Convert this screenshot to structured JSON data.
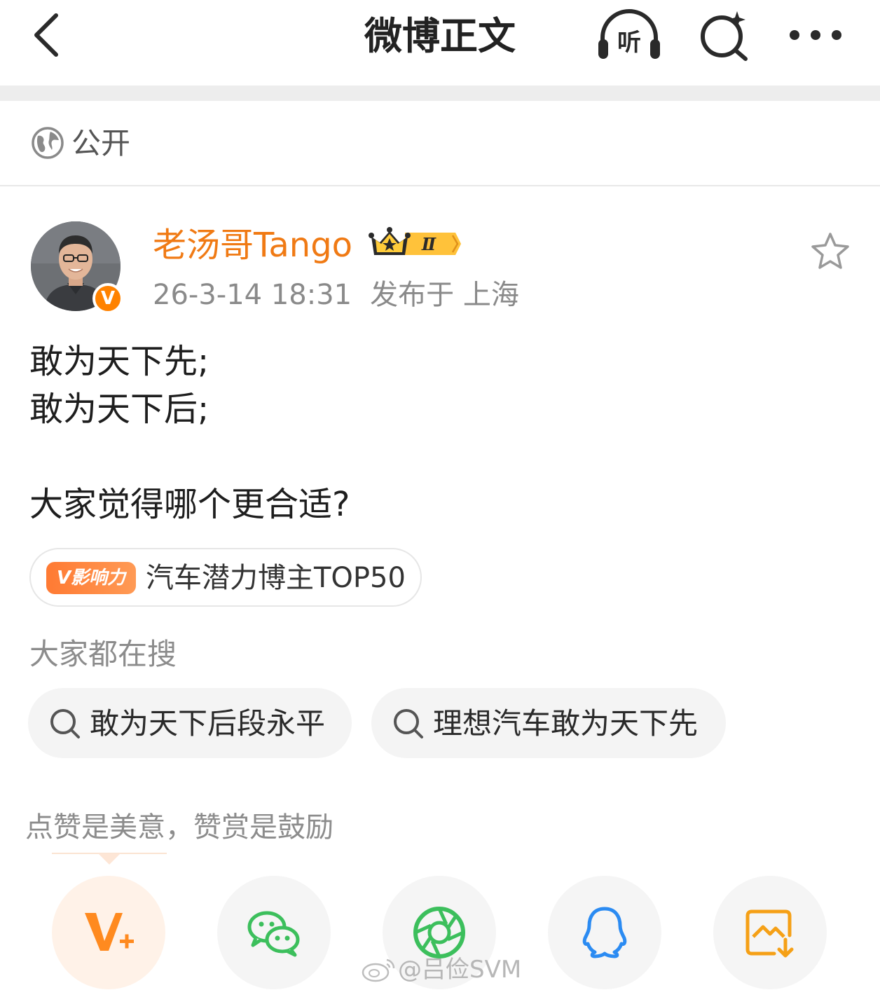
{
  "header": {
    "title": "微博正文",
    "listen_label": "听"
  },
  "visibility": {
    "label": "公开"
  },
  "post": {
    "author": {
      "name": "老汤哥Tango",
      "verified_mark": "V",
      "badge_level": "Ⅱ"
    },
    "time": "26-3-14 18:31",
    "location": "发布于 上海",
    "body": {
      "line1": "敢为天下先;",
      "line2": "敢为天下后;",
      "line3": "大家觉得哪个更合适?"
    },
    "influence": {
      "badge": "V影响力",
      "text": "汽车潜力博主TOP50"
    }
  },
  "search": {
    "heading": "大家都在搜",
    "chips": [
      {
        "label": "敢为天下后段永平"
      },
      {
        "label": "理想汽车敢为天下先"
      }
    ]
  },
  "reward": {
    "text": "点赞是美意，赞赏是鼓励"
  },
  "share": {
    "buttons": [
      {
        "icon": "vplus-icon"
      },
      {
        "icon": "wechat-icon"
      },
      {
        "icon": "moments-icon"
      },
      {
        "icon": "qq-icon"
      },
      {
        "icon": "save-image-icon"
      }
    ]
  },
  "watermark": {
    "text": "@吕俭SVM"
  },
  "colors": {
    "author_orange": "#f07a14",
    "accent_orange": "#ff8200",
    "wechat_green": "#3cbf5c",
    "qq_blue": "#2b8bf2",
    "save_orange": "#f5a016"
  }
}
